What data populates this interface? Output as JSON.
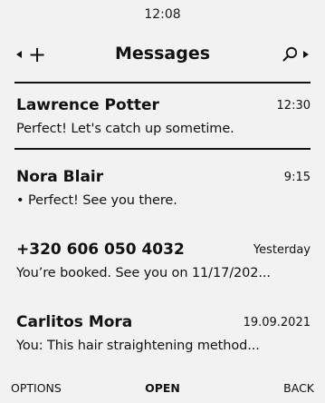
{
  "status": {
    "time": "12:08"
  },
  "header": {
    "title": "Messages"
  },
  "conversations": [
    {
      "name": "Lawrence Potter",
      "time": "12:30",
      "preview": "Perfect! Let's catch up sometime."
    },
    {
      "name": "Nora Blair",
      "time": "9:15",
      "preview": "• Perfect! See you there."
    },
    {
      "name": "+320 606 050 4032",
      "time": "Yesterday",
      "preview": "You’re booked. See you on 11/17/202..."
    },
    {
      "name": "Carlitos Mora",
      "time": "19.09.2021",
      "preview": "You: This hair straightening method..."
    }
  ],
  "softkeys": {
    "left": "OPTIONS",
    "center": "OPEN",
    "right": "BACK"
  },
  "icons": {
    "left_arrow": "triangle-left-icon",
    "new": "plus-icon",
    "search": "search-icon",
    "right_arrow": "triangle-right-icon"
  }
}
